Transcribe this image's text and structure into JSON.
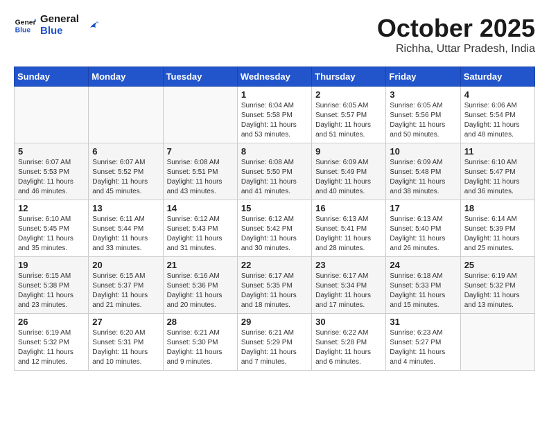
{
  "header": {
    "logo_line1": "General",
    "logo_line2": "Blue",
    "month": "October 2025",
    "location": "Richha, Uttar Pradesh, India"
  },
  "weekdays": [
    "Sunday",
    "Monday",
    "Tuesday",
    "Wednesday",
    "Thursday",
    "Friday",
    "Saturday"
  ],
  "weeks": [
    [
      {
        "day": "",
        "info": ""
      },
      {
        "day": "",
        "info": ""
      },
      {
        "day": "",
        "info": ""
      },
      {
        "day": "1",
        "info": "Sunrise: 6:04 AM\nSunset: 5:58 PM\nDaylight: 11 hours and 53 minutes."
      },
      {
        "day": "2",
        "info": "Sunrise: 6:05 AM\nSunset: 5:57 PM\nDaylight: 11 hours and 51 minutes."
      },
      {
        "day": "3",
        "info": "Sunrise: 6:05 AM\nSunset: 5:56 PM\nDaylight: 11 hours and 50 minutes."
      },
      {
        "day": "4",
        "info": "Sunrise: 6:06 AM\nSunset: 5:54 PM\nDaylight: 11 hours and 48 minutes."
      }
    ],
    [
      {
        "day": "5",
        "info": "Sunrise: 6:07 AM\nSunset: 5:53 PM\nDaylight: 11 hours and 46 minutes."
      },
      {
        "day": "6",
        "info": "Sunrise: 6:07 AM\nSunset: 5:52 PM\nDaylight: 11 hours and 45 minutes."
      },
      {
        "day": "7",
        "info": "Sunrise: 6:08 AM\nSunset: 5:51 PM\nDaylight: 11 hours and 43 minutes."
      },
      {
        "day": "8",
        "info": "Sunrise: 6:08 AM\nSunset: 5:50 PM\nDaylight: 11 hours and 41 minutes."
      },
      {
        "day": "9",
        "info": "Sunrise: 6:09 AM\nSunset: 5:49 PM\nDaylight: 11 hours and 40 minutes."
      },
      {
        "day": "10",
        "info": "Sunrise: 6:09 AM\nSunset: 5:48 PM\nDaylight: 11 hours and 38 minutes."
      },
      {
        "day": "11",
        "info": "Sunrise: 6:10 AM\nSunset: 5:47 PM\nDaylight: 11 hours and 36 minutes."
      }
    ],
    [
      {
        "day": "12",
        "info": "Sunrise: 6:10 AM\nSunset: 5:45 PM\nDaylight: 11 hours and 35 minutes."
      },
      {
        "day": "13",
        "info": "Sunrise: 6:11 AM\nSunset: 5:44 PM\nDaylight: 11 hours and 33 minutes."
      },
      {
        "day": "14",
        "info": "Sunrise: 6:12 AM\nSunset: 5:43 PM\nDaylight: 11 hours and 31 minutes."
      },
      {
        "day": "15",
        "info": "Sunrise: 6:12 AM\nSunset: 5:42 PM\nDaylight: 11 hours and 30 minutes."
      },
      {
        "day": "16",
        "info": "Sunrise: 6:13 AM\nSunset: 5:41 PM\nDaylight: 11 hours and 28 minutes."
      },
      {
        "day": "17",
        "info": "Sunrise: 6:13 AM\nSunset: 5:40 PM\nDaylight: 11 hours and 26 minutes."
      },
      {
        "day": "18",
        "info": "Sunrise: 6:14 AM\nSunset: 5:39 PM\nDaylight: 11 hours and 25 minutes."
      }
    ],
    [
      {
        "day": "19",
        "info": "Sunrise: 6:15 AM\nSunset: 5:38 PM\nDaylight: 11 hours and 23 minutes."
      },
      {
        "day": "20",
        "info": "Sunrise: 6:15 AM\nSunset: 5:37 PM\nDaylight: 11 hours and 21 minutes."
      },
      {
        "day": "21",
        "info": "Sunrise: 6:16 AM\nSunset: 5:36 PM\nDaylight: 11 hours and 20 minutes."
      },
      {
        "day": "22",
        "info": "Sunrise: 6:17 AM\nSunset: 5:35 PM\nDaylight: 11 hours and 18 minutes."
      },
      {
        "day": "23",
        "info": "Sunrise: 6:17 AM\nSunset: 5:34 PM\nDaylight: 11 hours and 17 minutes."
      },
      {
        "day": "24",
        "info": "Sunrise: 6:18 AM\nSunset: 5:33 PM\nDaylight: 11 hours and 15 minutes."
      },
      {
        "day": "25",
        "info": "Sunrise: 6:19 AM\nSunset: 5:32 PM\nDaylight: 11 hours and 13 minutes."
      }
    ],
    [
      {
        "day": "26",
        "info": "Sunrise: 6:19 AM\nSunset: 5:32 PM\nDaylight: 11 hours and 12 minutes."
      },
      {
        "day": "27",
        "info": "Sunrise: 6:20 AM\nSunset: 5:31 PM\nDaylight: 11 hours and 10 minutes."
      },
      {
        "day": "28",
        "info": "Sunrise: 6:21 AM\nSunset: 5:30 PM\nDaylight: 11 hours and 9 minutes."
      },
      {
        "day": "29",
        "info": "Sunrise: 6:21 AM\nSunset: 5:29 PM\nDaylight: 11 hours and 7 minutes."
      },
      {
        "day": "30",
        "info": "Sunrise: 6:22 AM\nSunset: 5:28 PM\nDaylight: 11 hours and 6 minutes."
      },
      {
        "day": "31",
        "info": "Sunrise: 6:23 AM\nSunset: 5:27 PM\nDaylight: 11 hours and 4 minutes."
      },
      {
        "day": "",
        "info": ""
      }
    ]
  ]
}
